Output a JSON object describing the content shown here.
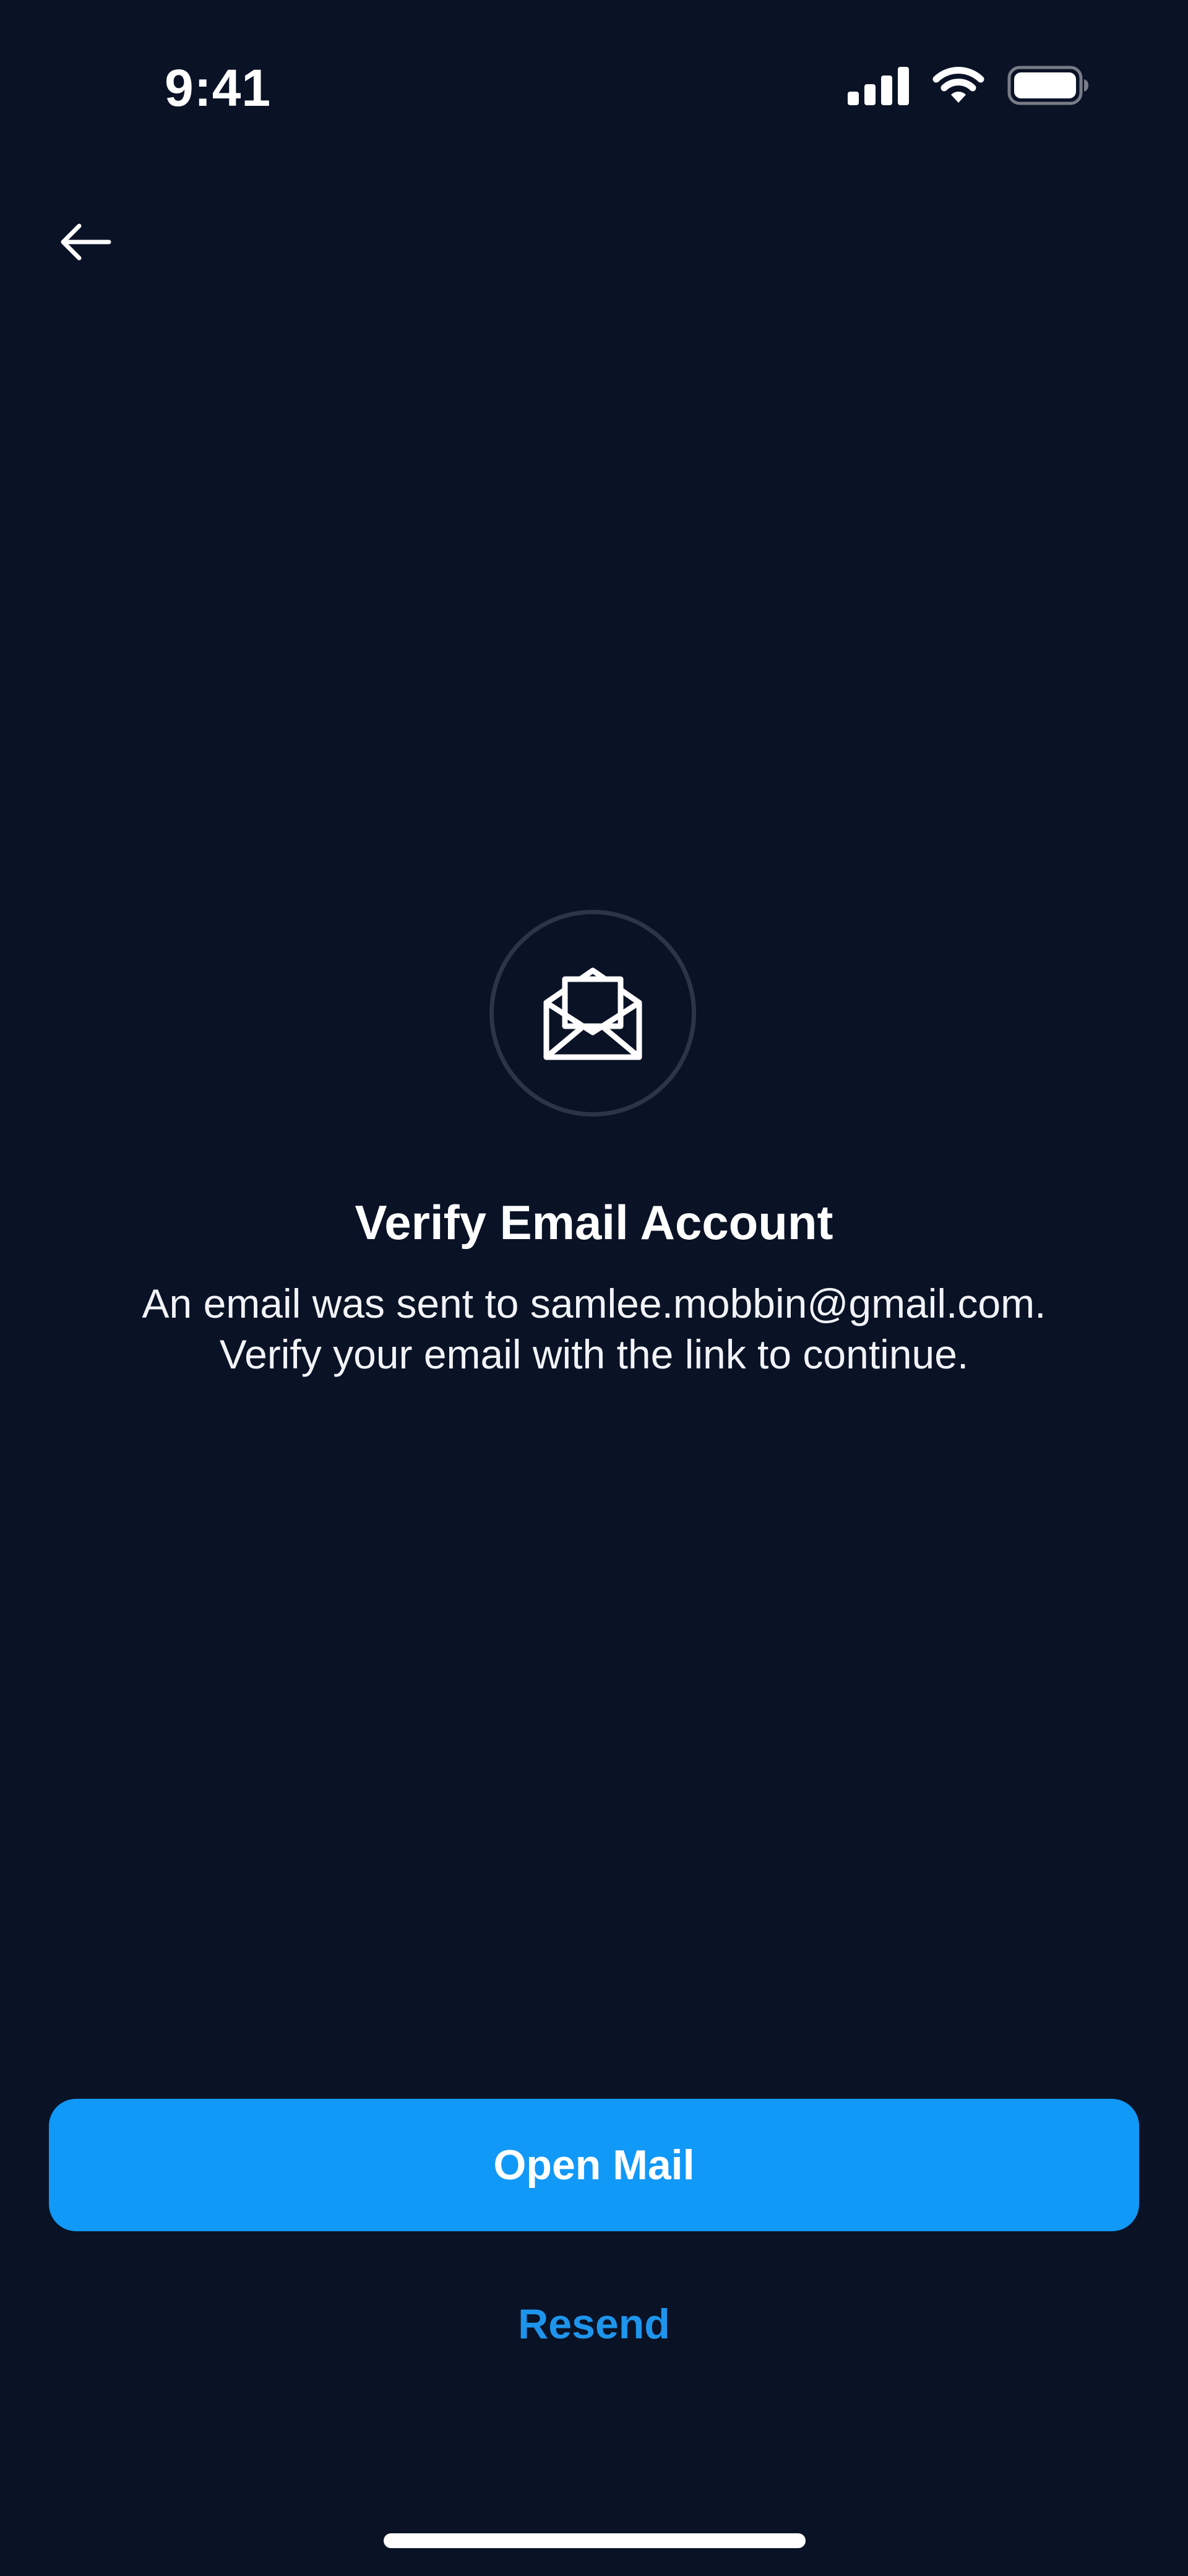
{
  "status_bar": {
    "time": "9:41",
    "icons": [
      "cellular-signal-icon",
      "wifi-icon",
      "battery-icon"
    ]
  },
  "nav": {
    "back_icon": "arrow-left-icon"
  },
  "hero": {
    "icon": "open-envelope-icon",
    "title": "Verify Email Account",
    "description_line1": "An email was sent to samlee.mobbin@gmail.com.",
    "description_line2": "Verify your email with the link to continue."
  },
  "actions": {
    "open_mail_label": "Open Mail",
    "resend_label": "Resend"
  },
  "colors": {
    "background": "#0a1226",
    "primary_button": "#1199f7",
    "link": "#1e95ec",
    "circle_border": "#2c3548",
    "text": "#ffffff"
  }
}
